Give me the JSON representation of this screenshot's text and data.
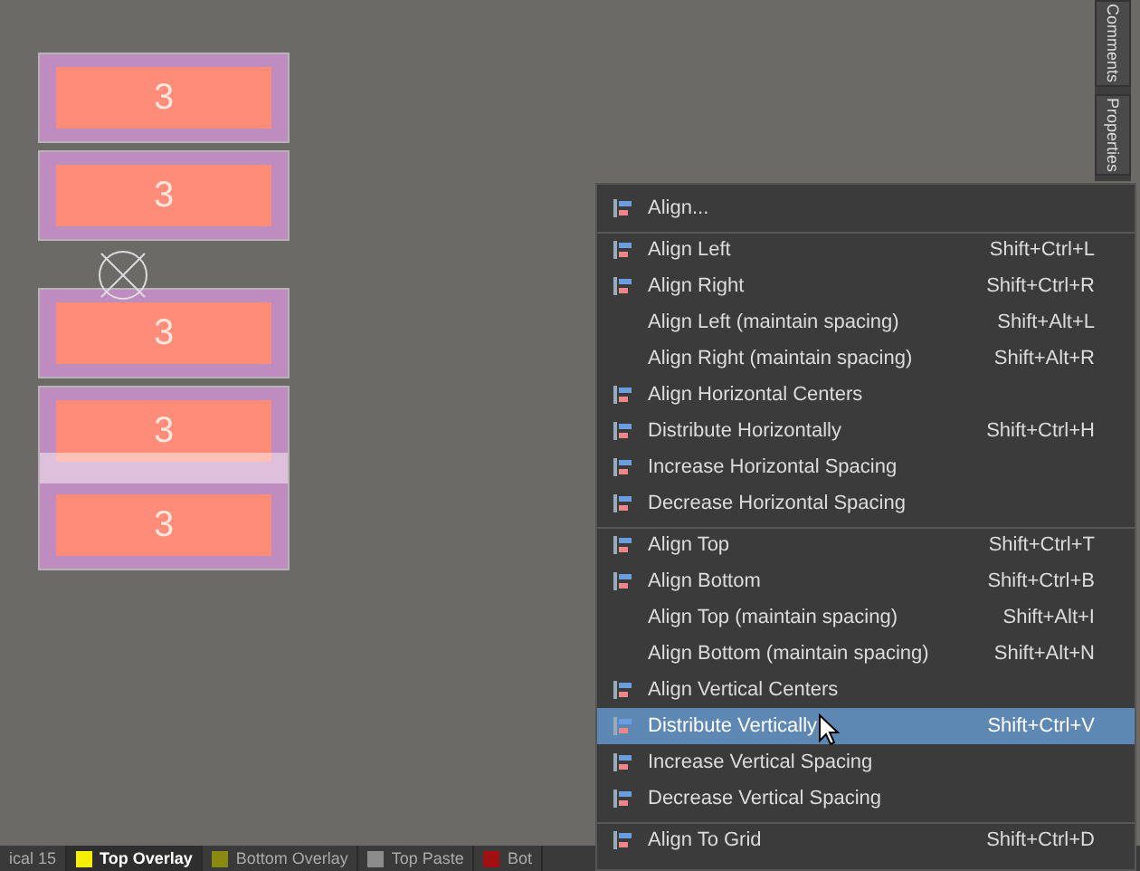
{
  "canvas": {
    "components": [
      {
        "pads": [
          "3"
        ],
        "highlighted": false
      },
      {
        "pads": [
          "3"
        ],
        "highlighted": false
      },
      {
        "pads": [
          "3"
        ],
        "highlighted": false
      },
      {
        "pads": [
          "3",
          "3"
        ],
        "highlighted": true
      }
    ]
  },
  "side_panel": {
    "tabs": [
      "Comments",
      "Properties"
    ]
  },
  "layer_tabs": [
    {
      "label": "ical 15",
      "selected": false
    },
    {
      "label": "Top Overlay",
      "color": "#f5f000",
      "selected": true
    },
    {
      "label": "Bottom Overlay",
      "color": "#8a8a10",
      "selected": false
    },
    {
      "label": "Top Paste",
      "color": "#8c8c8c",
      "selected": false
    },
    {
      "label": "Bot",
      "color": "#a01010",
      "selected": false
    }
  ],
  "context_menu": {
    "items": [
      {
        "label": "Align...",
        "has_icon": true,
        "separator_before": false,
        "selected": false
      },
      {
        "label": "Align Left",
        "shortcut": "Shift+Ctrl+L",
        "has_icon": true,
        "separator_before": true,
        "selected": false
      },
      {
        "label": "Align Right",
        "shortcut": "Shift+Ctrl+R",
        "has_icon": true,
        "separator_before": false,
        "selected": false
      },
      {
        "label": "Align Left (maintain spacing)",
        "shortcut": "Shift+Alt+L",
        "has_icon": false,
        "separator_before": false,
        "selected": false
      },
      {
        "label": "Align Right (maintain spacing)",
        "shortcut": "Shift+Alt+R",
        "has_icon": false,
        "separator_before": false,
        "selected": false
      },
      {
        "label": "Align Horizontal Centers",
        "has_icon": true,
        "separator_before": false,
        "selected": false
      },
      {
        "label": "Distribute Horizontally",
        "shortcut": "Shift+Ctrl+H",
        "has_icon": true,
        "separator_before": false,
        "selected": false
      },
      {
        "label": "Increase Horizontal Spacing",
        "has_icon": true,
        "separator_before": false,
        "selected": false
      },
      {
        "label": "Decrease Horizontal Spacing",
        "has_icon": true,
        "separator_before": false,
        "selected": false
      },
      {
        "label": "Align Top",
        "shortcut": "Shift+Ctrl+T",
        "has_icon": true,
        "separator_before": true,
        "selected": false
      },
      {
        "label": "Align Bottom",
        "shortcut": "Shift+Ctrl+B",
        "has_icon": true,
        "separator_before": false,
        "selected": false
      },
      {
        "label": "Align Top (maintain spacing)",
        "shortcut": "Shift+Alt+I",
        "has_icon": false,
        "separator_before": false,
        "selected": false
      },
      {
        "label": "Align Bottom (maintain spacing)",
        "shortcut": "Shift+Alt+N",
        "has_icon": false,
        "separator_before": false,
        "selected": false
      },
      {
        "label": "Align Vertical Centers",
        "has_icon": true,
        "separator_before": false,
        "selected": false
      },
      {
        "label": "Distribute Vertically",
        "shortcut": "Shift+Ctrl+V",
        "has_icon": true,
        "separator_before": false,
        "selected": true
      },
      {
        "label": "Increase Vertical Spacing",
        "has_icon": true,
        "separator_before": false,
        "selected": false
      },
      {
        "label": "Decrease Vertical Spacing",
        "has_icon": true,
        "separator_before": false,
        "selected": false
      },
      {
        "label": "Align To Grid",
        "shortcut": "Shift+Ctrl+D",
        "has_icon": true,
        "separator_before": true,
        "selected": false
      }
    ]
  }
}
